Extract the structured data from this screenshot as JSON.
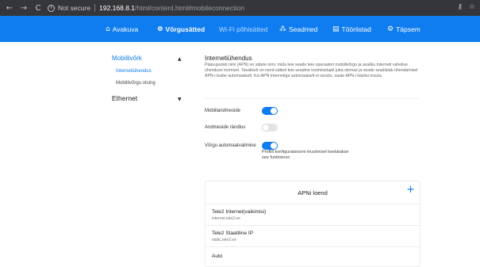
{
  "browser": {
    "back": "←",
    "forward": "→",
    "reload": "C",
    "info": "i",
    "security_label": "Not secure",
    "url_host": "192.168.8.1",
    "url_path": "/html/content.html#mobileconnection",
    "key_icon": "⚷",
    "star_icon": "☆"
  },
  "topnav": {
    "items": [
      {
        "icon": "⌂",
        "icon_name": "home-icon",
        "label": "Avakuva"
      },
      {
        "icon": "⊕",
        "icon_name": "globe-icon",
        "label": "Võrgusätted"
      },
      {
        "icon": "",
        "icon_name": "",
        "label": "Wi-Fi põhisätted"
      },
      {
        "icon": "⁂",
        "icon_name": "devices-icon",
        "label": "Seadmed"
      },
      {
        "icon": "▤",
        "icon_name": "tools-icon",
        "label": "Tööriistad"
      },
      {
        "icon": "⚙",
        "icon_name": "gear-icon",
        "label": "Täpsem"
      }
    ]
  },
  "sidebar": {
    "mobile_network": "Mobiilivõrk",
    "mobile_caret": "▲",
    "internet_connection": "Internetiühendus",
    "network_search": "Mobiilivõrgu otsing",
    "ethernet": "Ethernet",
    "ethernet_caret": "▼"
  },
  "main": {
    "title": "Internetiühendus",
    "description": "Pääsupunkti nimi (APN) on sätete nimi, mida teie seade teie operaatori mobiilivõrgu ja avaliku Interneti vahelise ühenduse loomisel. Tavaliselt on need sätted teie seadme tootmisetapil juba olemas ja seade seadistab ühendamisel APN-i teabe automaatselt. Kui APN Internetiga automaatselt ei seostu, saate APN-i käsitsi muuta.",
    "mobile_data_label": "Mobiilandmeside",
    "mobile_data_on": true,
    "roaming_label": "Andmeside rändlus",
    "roaming_on": false,
    "auto_select_label": "Võrgu automaatvalimine",
    "auto_select_on": true,
    "auto_select_note": "Profiili konfiguratsiooni muutmisel keelatakse see funktsioon"
  },
  "apn": {
    "title": "APNi loend",
    "add_icon": "+",
    "items": [
      {
        "name": "Tele2 Internet(vaikimisi)",
        "sub": "internet.tele2.ee"
      },
      {
        "name": "Tele2 Staatiline IP",
        "sub": "static.tele2.ee"
      },
      {
        "name": "Auto",
        "sub": ""
      }
    ]
  },
  "colors": {
    "accent": "#0f7cf0",
    "chrome": "#35363a"
  }
}
